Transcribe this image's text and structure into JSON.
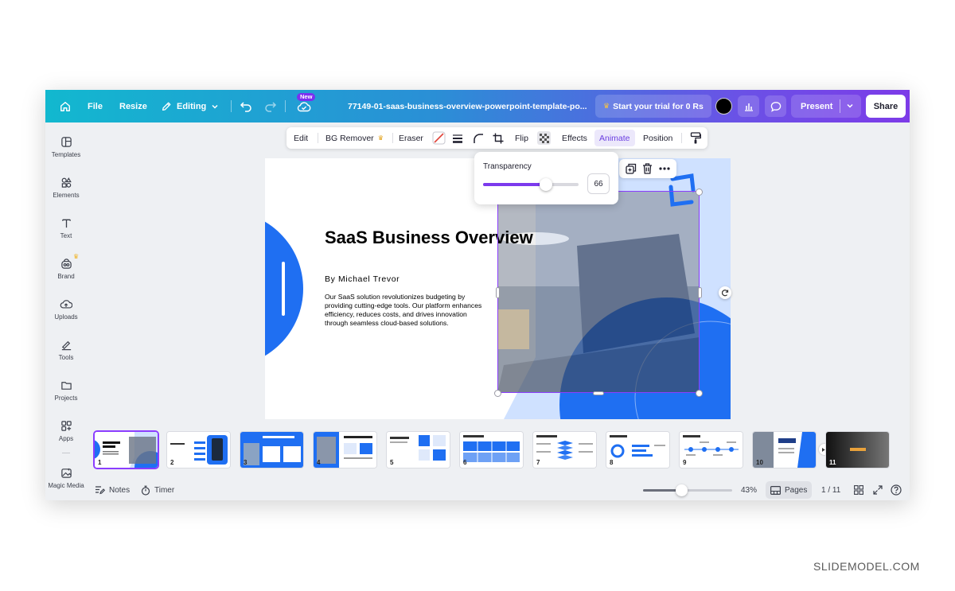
{
  "topbar": {
    "file": "File",
    "resize": "Resize",
    "editing": "Editing",
    "new_badge": "New",
    "filename": "77149-01-saas-business-overview-powerpoint-template-po...",
    "trial": "Start your trial for 0 Rs",
    "present": "Present",
    "share": "Share"
  },
  "sidebar": {
    "items": [
      {
        "label": "Templates",
        "icon": "templates-icon"
      },
      {
        "label": "Elements",
        "icon": "elements-icon"
      },
      {
        "label": "Text",
        "icon": "text-icon"
      },
      {
        "label": "Brand",
        "icon": "brand-icon"
      },
      {
        "label": "Uploads",
        "icon": "uploads-icon"
      },
      {
        "label": "Tools",
        "icon": "tools-icon"
      },
      {
        "label": "Projects",
        "icon": "projects-icon"
      },
      {
        "label": "Apps",
        "icon": "apps-icon"
      },
      {
        "label": "Magic Media",
        "icon": "magic-media-icon"
      }
    ]
  },
  "context_toolbar": {
    "edit": "Edit",
    "bg_remover": "BG Remover",
    "eraser": "Eraser",
    "flip": "Flip",
    "effects": "Effects",
    "animate": "Animate",
    "position": "Position"
  },
  "transparency": {
    "label": "Transparency",
    "value": "66",
    "level": 0.66
  },
  "slide": {
    "title": "SaaS Business Overview",
    "author": "By Michael Trevor",
    "description": "Our SaaS solution revolutionizes budgeting by providing cutting-edge tools. Our platform enhances efficiency, reduces costs, and drives innovation through seamless cloud-based solutions."
  },
  "pages": {
    "thumbnails": [
      "1",
      "2",
      "3",
      "4",
      "5",
      "6",
      "7",
      "8",
      "9",
      "10",
      "11"
    ],
    "active": 1
  },
  "bottombar": {
    "notes": "Notes",
    "timer": "Timer",
    "zoom": "43%",
    "zoom_level": 0.43,
    "pages_label": "Pages",
    "page_count": "1 / 11"
  },
  "watermark": "SLIDEMODEL.COM",
  "colors": {
    "accent_purple": "#8b3dff",
    "slide_blue": "#1f6ff2",
    "slide_light_blue": "#cfe1ff"
  }
}
